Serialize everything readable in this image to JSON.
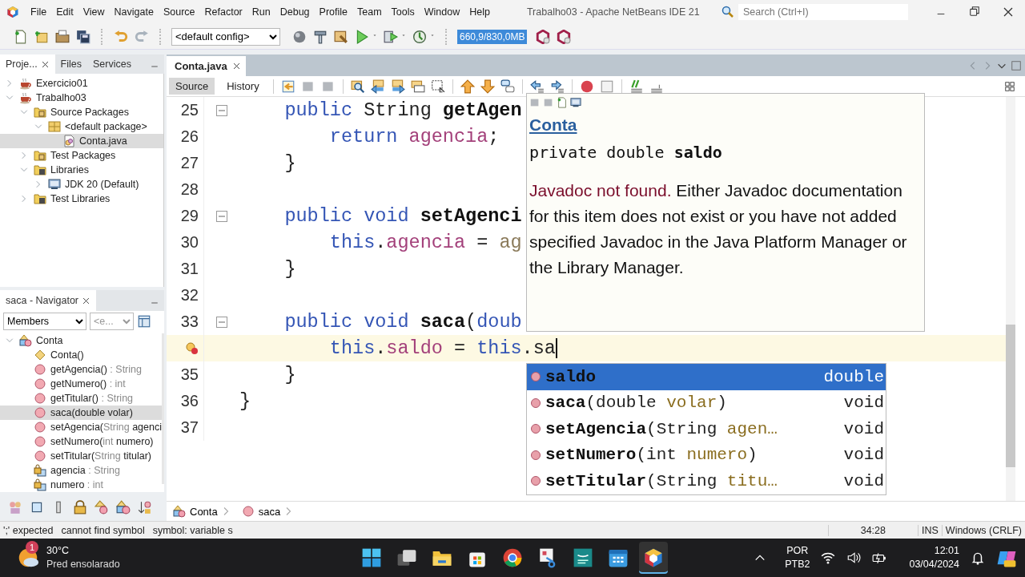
{
  "menubar": {
    "items": [
      "File",
      "Edit",
      "View",
      "Navigate",
      "Source",
      "Refactor",
      "Run",
      "Debug",
      "Profile",
      "Team",
      "Tools",
      "Window",
      "Help"
    ],
    "title": "Trabalho03 - Apache NetBeans IDE 21",
    "search": {
      "placeholder": "Search (Ctrl+I)"
    }
  },
  "toolbar": {
    "config": "<default config>",
    "memory": "660,9/830,0MB"
  },
  "projects": {
    "tabs": [
      {
        "label": "Proje...",
        "selected": true
      },
      {
        "label": "Files",
        "selected": false
      },
      {
        "label": "Services",
        "selected": false
      }
    ],
    "tree": [
      {
        "label": "Exercicio01",
        "kind": "project",
        "expanded": false,
        "selected": false
      },
      {
        "label": "Trabalho03",
        "kind": "project",
        "expanded": true,
        "selected": false,
        "children": [
          {
            "label": "Source Packages",
            "kind": "packages",
            "expanded": true,
            "selected": false,
            "children": [
              {
                "label": "<default package>",
                "kind": "package",
                "expanded": true,
                "selected": false,
                "children": [
                  {
                    "label": "Conta.java",
                    "kind": "java",
                    "selected": true
                  }
                ]
              }
            ]
          },
          {
            "label": "Test Packages",
            "kind": "packages",
            "expanded": false,
            "selected": false
          },
          {
            "label": "Libraries",
            "kind": "library",
            "expanded": true,
            "selected": false,
            "children": [
              {
                "label": "JDK 20 (Default)",
                "kind": "jdk",
                "expanded": false,
                "selected": false
              }
            ]
          },
          {
            "label": "Test Libraries",
            "kind": "library",
            "expanded": false,
            "selected": false
          }
        ]
      }
    ]
  },
  "navigator": {
    "title": "saca - Navigator",
    "filter": "Members",
    "scope": "<e...",
    "tree": [
      {
        "label": [
          {
            "text": "Conta",
            "muted": false
          }
        ],
        "kind": "class",
        "expanded": true,
        "selected": false,
        "children": [
          {
            "label": [
              {
                "text": "Conta()",
                "muted": false
              }
            ],
            "kind": "constructor",
            "selected": false
          },
          {
            "label": [
              {
                "text": "getAgencia()",
                "muted": false
              },
              {
                "text": " : String",
                "muted": true
              }
            ],
            "kind": "method",
            "selected": false
          },
          {
            "label": [
              {
                "text": "getNumero()",
                "muted": false
              },
              {
                "text": " : int",
                "muted": true
              }
            ],
            "kind": "method",
            "selected": false
          },
          {
            "label": [
              {
                "text": "getTitular()",
                "muted": false
              },
              {
                "text": " : String",
                "muted": true
              }
            ],
            "kind": "method",
            "selected": false
          },
          {
            "label": [
              {
                "text": "saca(double volar)",
                "muted": false
              }
            ],
            "kind": "method",
            "selected": true
          },
          {
            "label": [
              {
                "text": "setAgencia(",
                "muted": false
              },
              {
                "text": "String",
                "muted": true
              },
              {
                "text": " agenci",
                "muted": false
              }
            ],
            "kind": "method",
            "selected": false
          },
          {
            "label": [
              {
                "text": "setNumero(",
                "muted": false
              },
              {
                "text": "int",
                "muted": true
              },
              {
                "text": " numero)",
                "muted": false
              }
            ],
            "kind": "method",
            "selected": false
          },
          {
            "label": [
              {
                "text": "setTitular(",
                "muted": false
              },
              {
                "text": "String",
                "muted": true
              },
              {
                "text": " titular)",
                "muted": false
              }
            ],
            "kind": "method",
            "selected": false
          },
          {
            "label": [
              {
                "text": "agencia",
                "muted": false
              },
              {
                "text": " : String",
                "muted": true
              }
            ],
            "kind": "field",
            "selected": false
          },
          {
            "label": [
              {
                "text": "numero",
                "muted": false
              },
              {
                "text": " : int",
                "muted": true
              }
            ],
            "kind": "field",
            "selected": false
          }
        ]
      }
    ]
  },
  "editor": {
    "tabs": [
      {
        "label": "Conta.java",
        "selected": true
      }
    ],
    "views": [
      {
        "label": "Source",
        "selected": true
      },
      {
        "label": "History",
        "selected": false
      }
    ],
    "lines": [
      {
        "number": "25",
        "fold": true,
        "current": false,
        "caret": false,
        "tokens": [
          {
            "text": "    public",
            "kind": "keyword"
          },
          {
            "text": " String ",
            "kind": "plain"
          },
          {
            "text": "getAgen",
            "kind": "method"
          }
        ]
      },
      {
        "number": "26",
        "fold": false,
        "current": false,
        "caret": false,
        "tokens": [
          {
            "text": "        return",
            "kind": "keyword"
          },
          {
            "text": " agencia",
            "kind": "field"
          },
          {
            "text": ";",
            "kind": "plain"
          }
        ]
      },
      {
        "number": "27",
        "fold": false,
        "current": false,
        "caret": false,
        "tokens": [
          {
            "text": "    }",
            "kind": "plain"
          }
        ]
      },
      {
        "number": "28",
        "fold": false,
        "current": false,
        "caret": false
      },
      {
        "number": "29",
        "fold": true,
        "current": false,
        "caret": false,
        "tokens": [
          {
            "text": "    public",
            "kind": "keyword"
          },
          {
            "text": " void",
            "kind": "keyword"
          },
          {
            "text": " setAgenci",
            "kind": "method"
          }
        ]
      },
      {
        "number": "30",
        "fold": false,
        "current": false,
        "caret": false,
        "tokens": [
          {
            "text": "        this",
            "kind": "keyword"
          },
          {
            "text": ".",
            "kind": "plain"
          },
          {
            "text": "agencia",
            "kind": "field"
          },
          {
            "text": " = ",
            "kind": "plain"
          },
          {
            "text": "ag",
            "kind": "argument"
          }
        ]
      },
      {
        "number": "31",
        "fold": false,
        "current": false,
        "caret": false,
        "tokens": [
          {
            "text": "    }",
            "kind": "plain"
          }
        ]
      },
      {
        "number": "32",
        "fold": false,
        "current": false,
        "caret": false
      },
      {
        "number": "33",
        "fold": true,
        "current": false,
        "caret": false,
        "tokens": [
          {
            "text": "    public",
            "kind": "keyword"
          },
          {
            "text": " void",
            "kind": "keyword"
          },
          {
            "text": " saca",
            "kind": "method"
          },
          {
            "text": "(",
            "kind": "plain"
          },
          {
            "text": "doub",
            "kind": "keyword"
          }
        ]
      },
      {
        "kind": "error",
        "fold": false,
        "current": true,
        "caret": true,
        "tokens": [
          {
            "text": "        this",
            "kind": "keyword"
          },
          {
            "text": ".",
            "kind": "plain"
          },
          {
            "text": "saldo",
            "kind": "field"
          },
          {
            "text": " = ",
            "kind": "plain"
          },
          {
            "text": "this",
            "kind": "keyword"
          },
          {
            "text": ".sa",
            "kind": "plain"
          }
        ]
      },
      {
        "number": "35",
        "fold": false,
        "current": false,
        "caret": false,
        "tokens": [
          {
            "text": "    }",
            "kind": "plain"
          }
        ]
      },
      {
        "number": "36",
        "fold": false,
        "current": false,
        "caret": false,
        "tokens": [
          {
            "text": "}",
            "kind": "plain"
          }
        ]
      },
      {
        "number": "37",
        "fold": false,
        "current": false,
        "caret": false
      }
    ],
    "javadoc": {
      "link": "Conta",
      "signature": "private double **saldo**",
      "notice": "Javadoc not found.",
      "message": "Either Javadoc documentation for this item does not exist or you have not added specified Javadoc in the Java Platform Manager or the Library Manager."
    },
    "completion": [
      {
        "segments": [
          {
            "text": "saldo",
            "kind": "name"
          }
        ],
        "type": "double",
        "selected": true
      },
      {
        "segments": [
          {
            "text": "saca",
            "kind": "name"
          },
          {
            "text": "(double ",
            "kind": "plain"
          },
          {
            "text": "volar",
            "kind": "param"
          },
          {
            "text": ")",
            "kind": "plain"
          }
        ],
        "type": "void",
        "selected": false
      },
      {
        "segments": [
          {
            "text": "setAgencia",
            "kind": "name"
          },
          {
            "text": "(String ",
            "kind": "plain"
          },
          {
            "text": "agen…",
            "kind": "param"
          }
        ],
        "type": "void",
        "selected": false
      },
      {
        "segments": [
          {
            "text": "setNumero",
            "kind": "name"
          },
          {
            "text": "(int ",
            "kind": "plain"
          },
          {
            "text": "numero",
            "kind": "param"
          },
          {
            "text": ")",
            "kind": "plain"
          }
        ],
        "type": "void",
        "selected": false
      },
      {
        "segments": [
          {
            "text": "setTitular",
            "kind": "name"
          },
          {
            "text": "(String ",
            "kind": "plain"
          },
          {
            "text": "titu…",
            "kind": "param"
          }
        ],
        "type": "void",
        "selected": false
      }
    ],
    "breadcrumbs": [
      {
        "label": "Conta",
        "kind": "class"
      },
      {
        "label": "saca",
        "kind": "method"
      }
    ]
  },
  "status_bar": {
    "messages": [
      "';' expected",
      "cannot find symbol",
      "symbol: variable s"
    ],
    "position": "34:28",
    "mode": "INS",
    "line_endings": "Windows (CRLF)"
  },
  "taskbar": {
    "weather": {
      "badge": "1",
      "temperature": "30°C",
      "condition": "Pred ensolarado"
    },
    "apps": [
      {
        "kind": "start",
        "active": false
      },
      {
        "kind": "taskview",
        "active": false
      },
      {
        "kind": "folder",
        "active": false
      },
      {
        "kind": "store",
        "active": false
      },
      {
        "kind": "browser",
        "active": false
      },
      {
        "kind": "snip",
        "active": false
      },
      {
        "kind": "reader",
        "active": false
      },
      {
        "kind": "calendar",
        "active": false
      },
      {
        "kind": "netbeans",
        "active": true
      }
    ],
    "language": "POR",
    "layout": "PTB2",
    "time": "12:01",
    "date": "03/04/2024"
  }
}
